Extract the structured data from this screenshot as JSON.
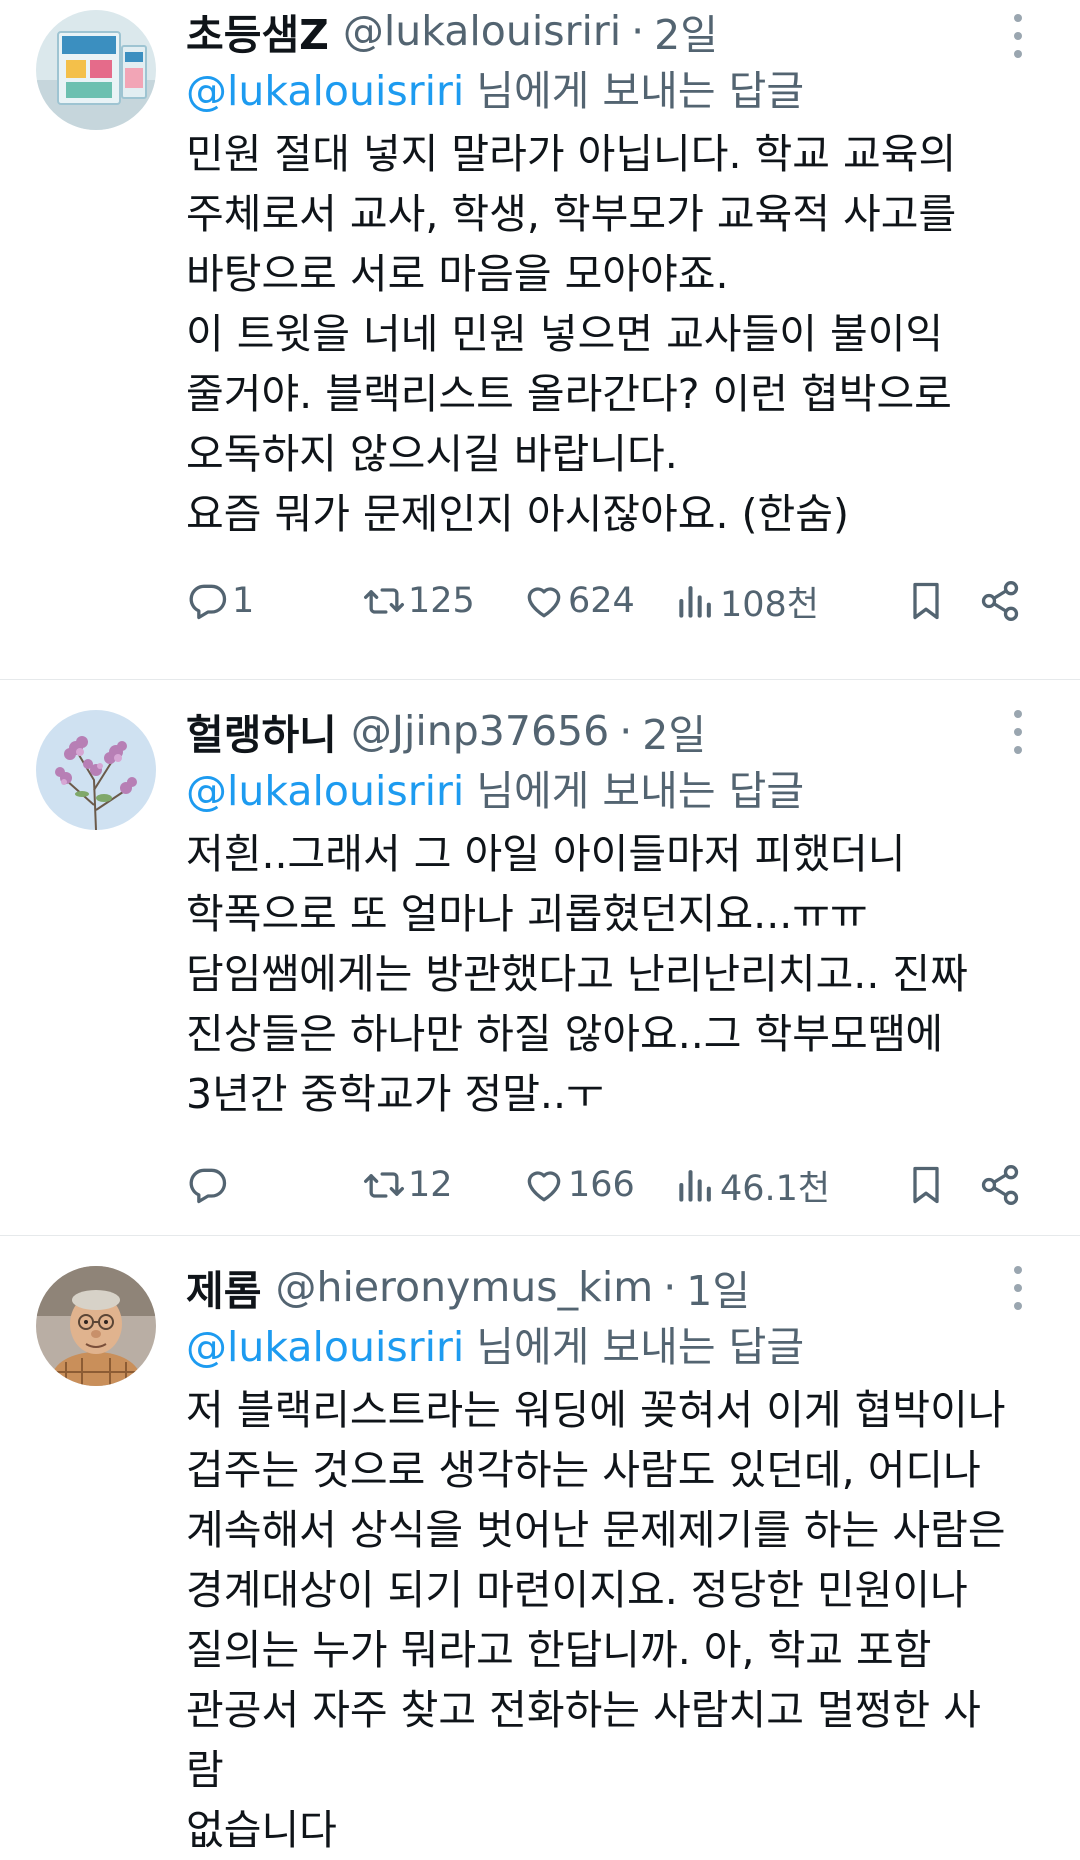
{
  "tweets": [
    {
      "name": "초등샘Z",
      "handle": "@lukalouisriri",
      "time": "2일",
      "reply_to_handle": "@lukalouisriri",
      "reply_to_suffix": "님에게 보내는 답글",
      "body": "민원 절대 넣지 말라가 아닙니다. 학교 교육의\n주체로서 교사, 학생, 학부모가 교육적 사고를\n바탕으로 서로 마음을 모아야죠.\n이 트윗을 너네 민원 넣으면 교사들이 불이익\n줄거야. 블랙리스트 올라간다? 이런 협박으로\n오독하지 않으시길 바랍니다.\n요즘 뭐가 문제인지 아시잖아요. (한숨)",
      "replies": "1",
      "retweets": "125",
      "likes": "624",
      "views": "108천",
      "avatar": "book-cover"
    },
    {
      "name": "헐랭하니",
      "handle": "@Jjinp37656",
      "time": "2일",
      "reply_to_handle": "@lukalouisriri",
      "reply_to_suffix": "님에게 보내는 답글",
      "body": "저흰..그래서 그 아일 아이들마저 피했더니\n학폭으로 또 얼마나 괴롭혔던지요...ㅠㅠ\n담임쌤에게는 방관했다고 난리난리치고.. 진짜\n진상들은 하나만 하질 않아요..그 학부모땜에\n3년간 중학교가 정말..ㅜ",
      "replies": "",
      "retweets": "12",
      "likes": "166",
      "views": "46.1천",
      "avatar": "lilac-flowers"
    },
    {
      "name": "제롬",
      "handle": "@hieronymus_kim",
      "time": "1일",
      "reply_to_handle": "@lukalouisriri",
      "reply_to_suffix": "님에게 보내는 답글",
      "body": "저 블랙리스트라는 워딩에 꽂혀서 이게 협박이나\n겁주는 것으로 생각하는 사람도 있던데, 어디나\n계속해서 상식을 벗어난 문제제기를 하는 사람은\n경계대상이 되기 마련이지요. 정당한 민원이나\n질의는 누가 뭐라고 한답니까. 아, 학교 포함\n관공서 자주 찾고 전화하는 사람치고 멀쩡한 사람\n없습니다",
      "avatar": "puppet-old-man"
    }
  ],
  "colors": {
    "link": "#1d9bf0",
    "muted": "#536471",
    "text": "#0f1419"
  },
  "icons": [
    "reply-icon",
    "retweet-icon",
    "like-icon",
    "views-icon",
    "bookmark-icon",
    "share-icon",
    "more-icon"
  ]
}
